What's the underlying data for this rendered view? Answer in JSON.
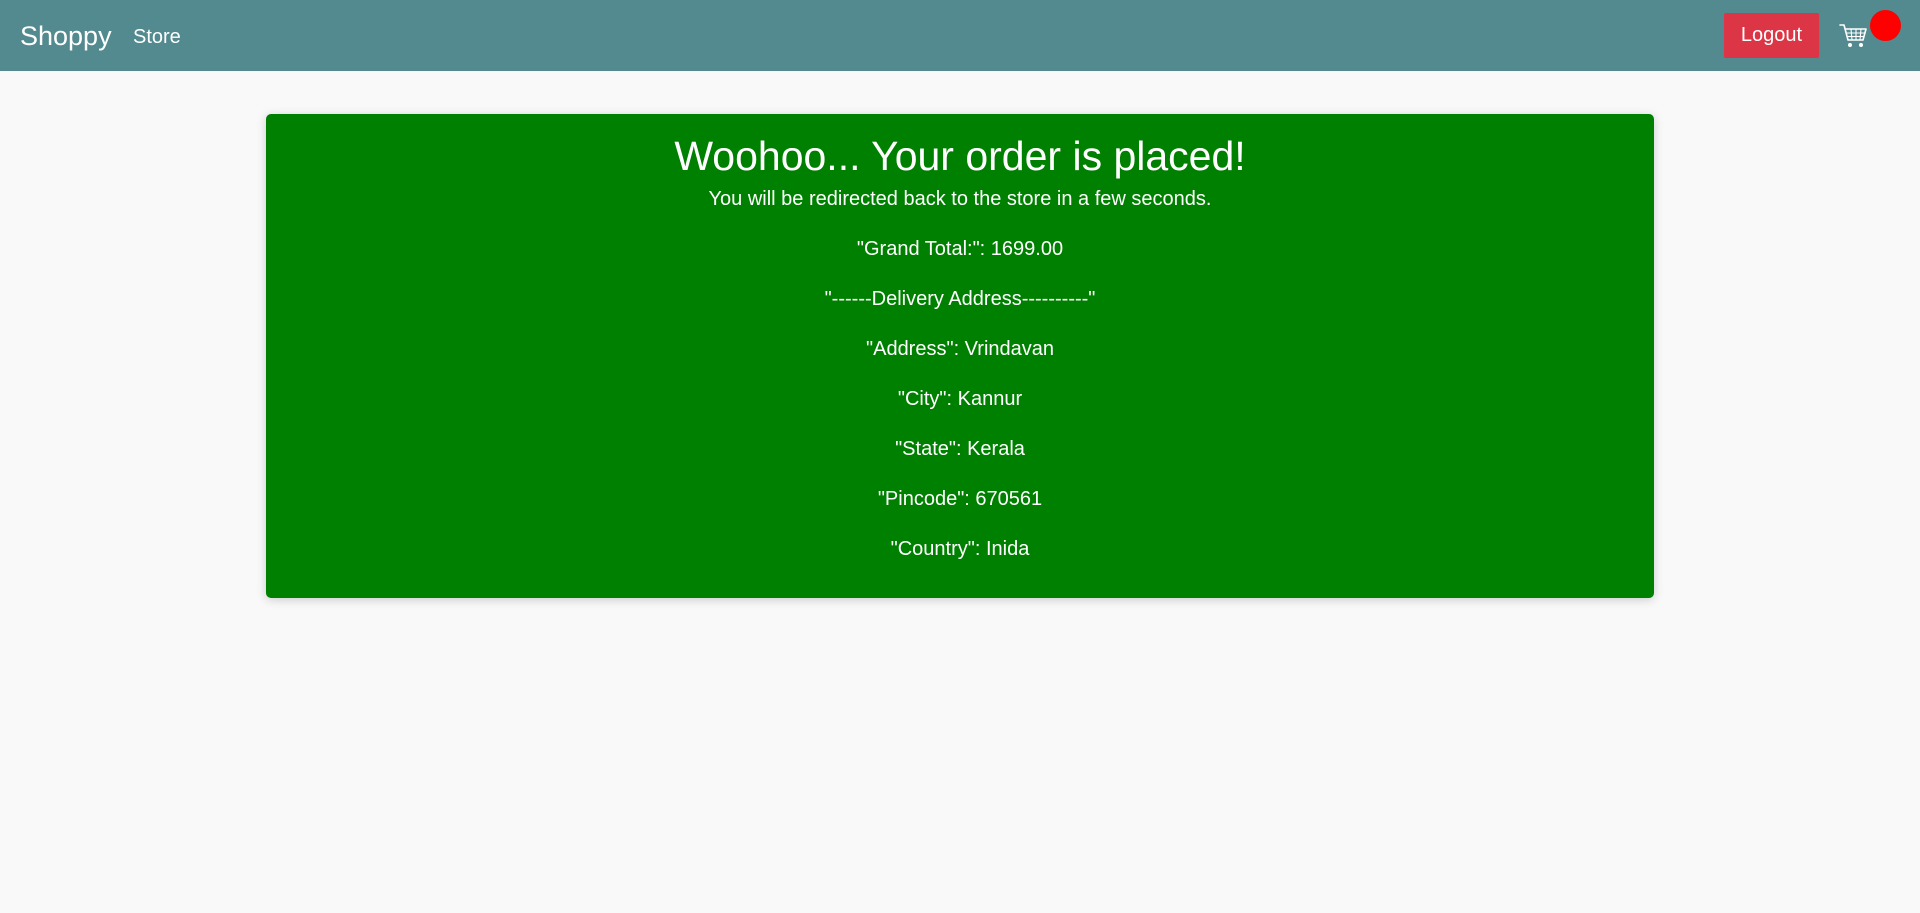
{
  "navbar": {
    "brand": "Shoppy",
    "store_link": "Store",
    "logout_label": "Logout",
    "cart_badge_color": "#ff0000"
  },
  "order": {
    "title": "Woohoo... Your order is placed!",
    "subtitle": "You will be redirected back to the store in a few seconds.",
    "lines": [
      "\"Grand Total:\": 1699.00",
      "\"------Delivery Address----------\"",
      "\"Address\": Vrindavan",
      "\"City\": Kannur",
      "\"State\": Kerala",
      "\"Pincode\": 670561",
      "\"Country\": Inida"
    ]
  },
  "colors": {
    "navbar_bg": "#528a8f",
    "card_bg": "#008000",
    "logout_bg": "#dc3545",
    "page_bg": "#f9f9f9"
  }
}
